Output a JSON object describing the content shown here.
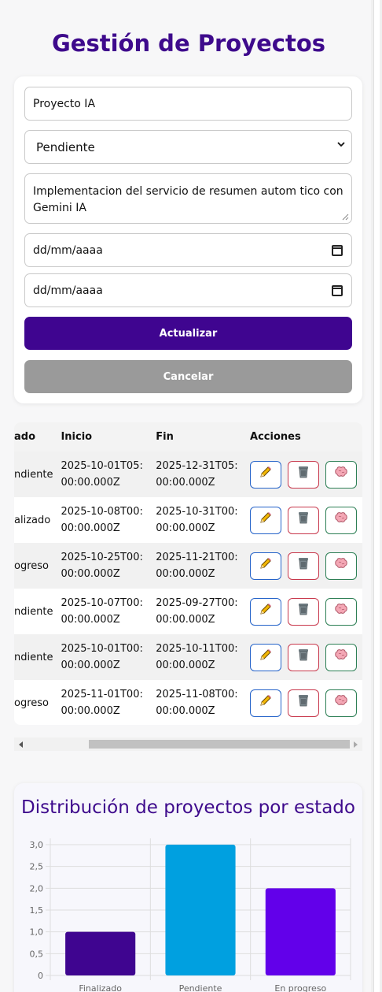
{
  "page": {
    "title": "Gestión de Proyectos"
  },
  "form": {
    "name_value": "Proyecto IA",
    "status_value": "Pendiente",
    "description_value": "Implementacion del servicio de resumen autom tico con Gemini IA",
    "start_date_placeholder": "dd/mm/aaaa",
    "end_date_placeholder": "dd/mm/aaaa",
    "update_label": "Actualizar",
    "cancel_label": "Cancelar"
  },
  "table": {
    "headers": {
      "estado": "ado",
      "inicio": "Inicio",
      "fin": "Fin",
      "acciones": "Acciones"
    },
    "rows": [
      {
        "estado": "ndiente",
        "inicio": "2025-10-01T05:00:00.000Z",
        "fin": "2025-12-31T05:00:00.000Z"
      },
      {
        "estado": "alizado",
        "inicio": "2025-10-08T00:00:00.000Z",
        "fin": "2025-10-31T00:00:00.000Z"
      },
      {
        "estado": "ogreso",
        "inicio": "2025-10-25T00:00:00.000Z",
        "fin": "2025-11-21T00:00:00.000Z"
      },
      {
        "estado": "ndiente",
        "inicio": "2025-10-07T00:00:00.000Z",
        "fin": "2025-09-27T00:00:00.000Z"
      },
      {
        "estado": "ndiente",
        "inicio": "2025-10-01T00:00:00.000Z",
        "fin": "2025-10-11T00:00:00.000Z"
      },
      {
        "estado": "ogreso",
        "inicio": "2025-11-01T00:00:00.000Z",
        "fin": "2025-11-08T00:00:00.000Z"
      }
    ],
    "action_icons": [
      "pencil-icon",
      "trash-icon",
      "brain-icon"
    ]
  },
  "chart_data": {
    "type": "bar",
    "title": "Distribución de proyectos por estado",
    "categories": [
      "Finalizado",
      "Pendiente",
      "En progreso"
    ],
    "values": [
      1,
      3,
      2
    ],
    "colors": [
      "#3f0590",
      "#00a0e0",
      "#6200ea"
    ],
    "ylim": [
      0,
      3
    ],
    "yticks": [
      "0",
      "0,5",
      "1,0",
      "1,5",
      "2,0",
      "2,5",
      "3,0"
    ],
    "grid": true
  },
  "colors": {
    "accent": "#3e0a8c",
    "update_button": "#3f0590",
    "cancel_button": "#9a9a9a",
    "edit_border": "#2563c9",
    "delete_border": "#c8384c",
    "ai_border": "#2d7f55"
  }
}
